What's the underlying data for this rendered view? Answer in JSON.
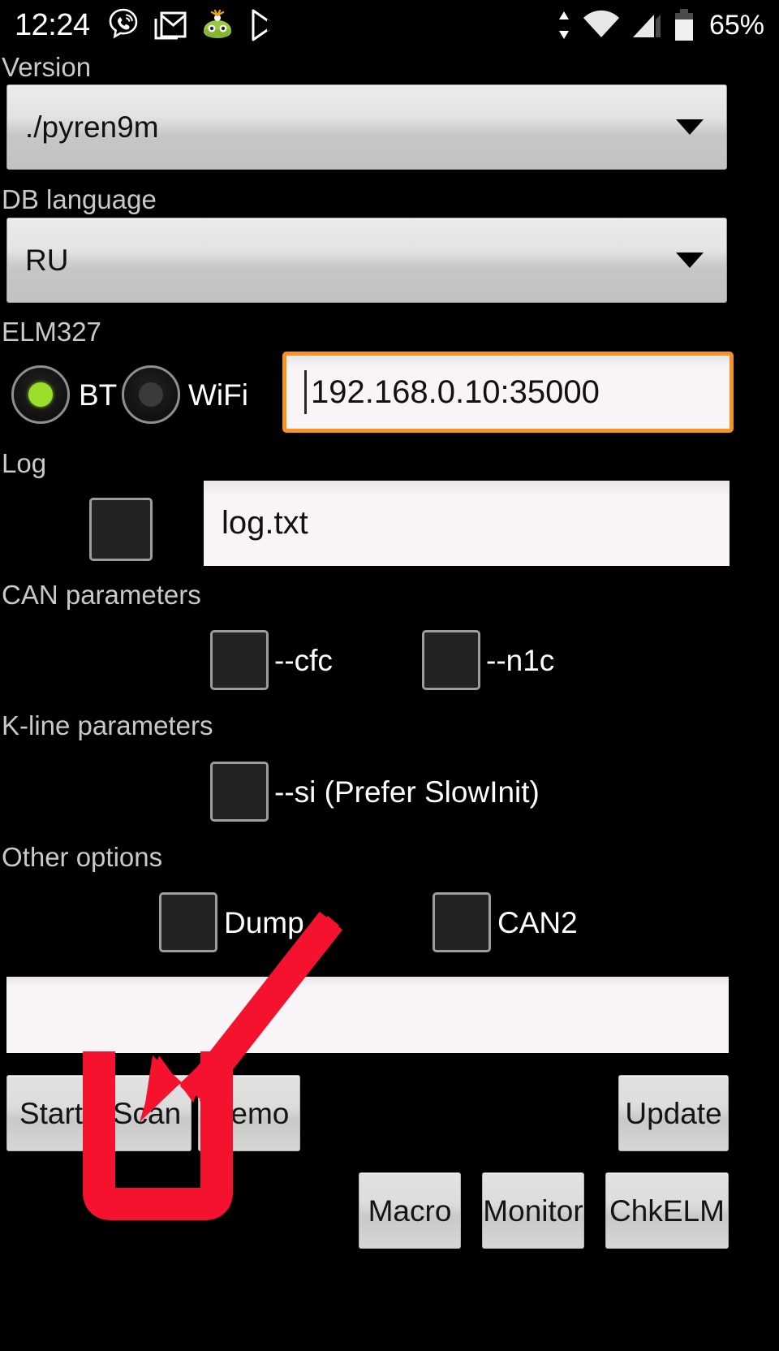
{
  "status_bar": {
    "clock": "12:24",
    "battery_percent": "65%",
    "left_icons": [
      "viber-icon",
      "gmail-icon",
      "green-app-icon",
      "play-store-icon"
    ],
    "right_icons": [
      "data-transfer-icon",
      "wifi-icon",
      "signal-bars-icon",
      "battery-icon"
    ]
  },
  "app": {
    "version": {
      "label": "Version",
      "selected": "./pyren9m"
    },
    "db_language": {
      "label": "DB language",
      "selected": "RU"
    },
    "elm327": {
      "label": "ELM327",
      "connection": {
        "selected": "BT",
        "options": [
          {
            "id": "bt",
            "label": "BT",
            "selected": true
          },
          {
            "id": "wifi",
            "label": "WiFi",
            "selected": false
          }
        ]
      },
      "address": {
        "value": "192.168.0.10:35000",
        "focused": true
      }
    },
    "log": {
      "label": "Log",
      "enabled": false,
      "filename": "log.txt"
    },
    "can_parameters": {
      "label": "CAN parameters",
      "options": [
        {
          "id": "cfc",
          "label": "--cfc",
          "checked": false
        },
        {
          "id": "n1c",
          "label": "--n1c",
          "checked": false
        }
      ]
    },
    "kline_parameters": {
      "label": "K-line parameters",
      "options": [
        {
          "id": "si",
          "label": "--si (Prefer SlowInit)",
          "checked": false
        }
      ]
    },
    "other_options": {
      "label": "Other options",
      "options": [
        {
          "id": "dump",
          "label": "Dump",
          "checked": false
        },
        {
          "id": "can2",
          "label": "CAN2",
          "checked": false
        }
      ]
    },
    "output_panel": {
      "text": ""
    },
    "buttons": {
      "primary_row": [
        "Start",
        "Scan",
        "Demo"
      ],
      "update": "Update",
      "secondary_row": [
        "Macro",
        "Monitor",
        "ChkELM"
      ]
    }
  },
  "annotation": {
    "type": "highlight-box-with-arrow",
    "target": "Scan",
    "color": "#f5122e"
  },
  "colors": {
    "background": "#000000",
    "accent_orange": "#f7931e",
    "radio_on_green": "#9ae02b",
    "annotation_red": "#f5122e",
    "panel_white": "#f8f4f8",
    "button_gray": "#d6d6d6"
  }
}
